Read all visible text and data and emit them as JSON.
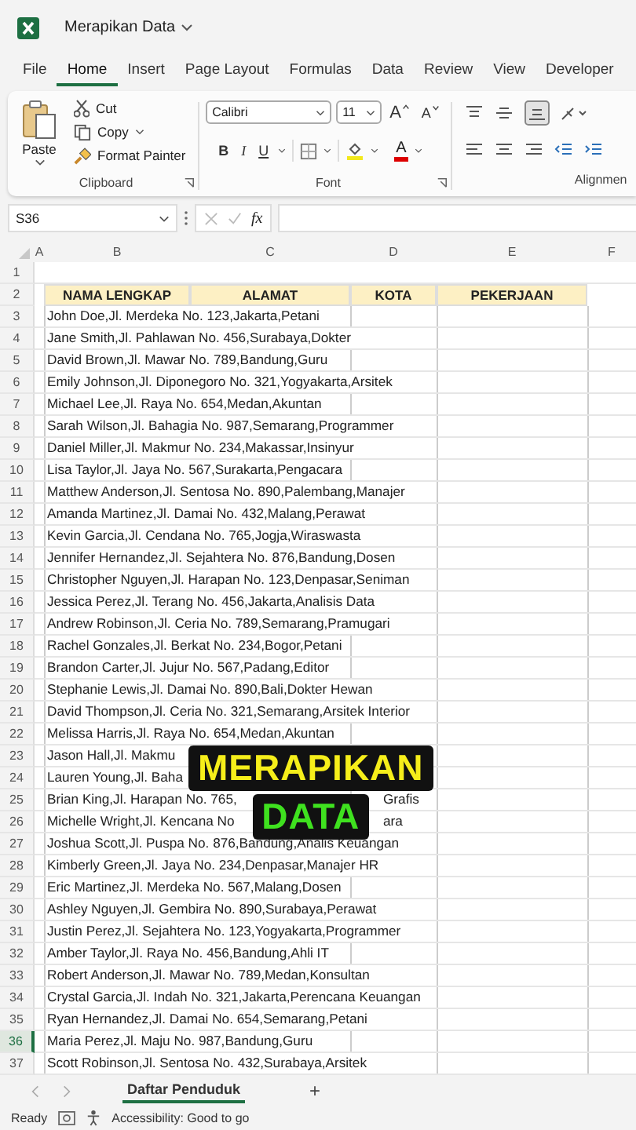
{
  "window": {
    "title": "Merapikan Data"
  },
  "menu_tabs": [
    {
      "label": "File",
      "selected": false
    },
    {
      "label": "Home",
      "selected": true
    },
    {
      "label": "Insert",
      "selected": false
    },
    {
      "label": "Page Layout",
      "selected": false
    },
    {
      "label": "Formulas",
      "selected": false
    },
    {
      "label": "Data",
      "selected": false
    },
    {
      "label": "Review",
      "selected": false
    },
    {
      "label": "View",
      "selected": false
    },
    {
      "label": "Developer",
      "selected": false
    }
  ],
  "ribbon": {
    "clipboard": {
      "paste": "Paste",
      "cut": "Cut",
      "copy": "Copy",
      "format_painter": "Format Painter",
      "label": "Clipboard"
    },
    "font": {
      "family": "Calibri",
      "size": "11",
      "grow": "A",
      "shrink": "A",
      "bold": "B",
      "italic": "I",
      "underline": "U",
      "color_letter": "A",
      "label": "Font"
    },
    "alignment": {
      "label": "Alignmen"
    }
  },
  "formula_bar": {
    "name_box": "S36",
    "function_label": "fx"
  },
  "columns": [
    "A",
    "B",
    "C",
    "D",
    "E",
    "F"
  ],
  "headers": [
    "NAMA LENGKAP",
    "ALAMAT",
    "KOTA",
    "PEKERJAAN"
  ],
  "rows": [
    {
      "number": "1",
      "selected": false
    },
    {
      "number": "2",
      "selected": false,
      "kind": "header"
    },
    {
      "number": "3",
      "selected": false,
      "text": "John Doe,Jl. Merdeka No. 123,Jakarta,Petani"
    },
    {
      "number": "4",
      "selected": false,
      "text": "Jane Smith,Jl. Pahlawan No. 456,Surabaya,Dokter"
    },
    {
      "number": "5",
      "selected": false,
      "text": "David Brown,Jl. Mawar No. 789,Bandung,Guru"
    },
    {
      "number": "6",
      "selected": false,
      "text": "Emily Johnson,Jl. Diponegoro No. 321,Yogyakarta,Arsitek"
    },
    {
      "number": "7",
      "selected": false,
      "text": "Michael Lee,Jl. Raya No. 654,Medan,Akuntan"
    },
    {
      "number": "8",
      "selected": false,
      "text": "Sarah Wilson,Jl. Bahagia No. 987,Semarang,Programmer"
    },
    {
      "number": "9",
      "selected": false,
      "text": "Daniel Miller,Jl. Makmur No. 234,Makassar,Insinyur"
    },
    {
      "number": "10",
      "selected": false,
      "text": "Lisa Taylor,Jl. Jaya No. 567,Surakarta,Pengacara"
    },
    {
      "number": "11",
      "selected": false,
      "text": "Matthew Anderson,Jl. Sentosa No. 890,Palembang,Manajer"
    },
    {
      "number": "12",
      "selected": false,
      "text": "Amanda Martinez,Jl. Damai No. 432,Malang,Perawat"
    },
    {
      "number": "13",
      "selected": false,
      "text": "Kevin Garcia,Jl. Cendana No. 765,Jogja,Wiraswasta"
    },
    {
      "number": "14",
      "selected": false,
      "text": "Jennifer Hernandez,Jl. Sejahtera No. 876,Bandung,Dosen"
    },
    {
      "number": "15",
      "selected": false,
      "text": "Christopher Nguyen,Jl. Harapan No. 123,Denpasar,Seniman"
    },
    {
      "number": "16",
      "selected": false,
      "text": "Jessica Perez,Jl. Terang No. 456,Jakarta,Analisis Data"
    },
    {
      "number": "17",
      "selected": false,
      "text": "Andrew Robinson,Jl. Ceria No. 789,Semarang,Pramugari"
    },
    {
      "number": "18",
      "selected": false,
      "text": "Rachel Gonzales,Jl. Berkat No. 234,Bogor,Petani"
    },
    {
      "number": "19",
      "selected": false,
      "text": "Brandon Carter,Jl. Jujur No. 567,Padang,Editor"
    },
    {
      "number": "20",
      "selected": false,
      "text": "Stephanie Lewis,Jl. Damai No. 890,Bali,Dokter Hewan"
    },
    {
      "number": "21",
      "selected": false,
      "text": "David Thompson,Jl. Ceria No. 321,Semarang,Arsitek Interior"
    },
    {
      "number": "22",
      "selected": false,
      "text": "Melissa Harris,Jl. Raya No. 654,Medan,Akuntan"
    },
    {
      "number": "23",
      "selected": false,
      "text": "Jason Hall,Jl. Makmu"
    },
    {
      "number": "24",
      "selected": false,
      "text": "Lauren Young,Jl. Baha"
    },
    {
      "number": "25",
      "selected": false,
      "text": "Brian King,Jl. Harapan No. 765,",
      "tail": "Grafis"
    },
    {
      "number": "26",
      "selected": false,
      "text": "Michelle Wright,Jl. Kencana No",
      "tail": "ara"
    },
    {
      "number": "27",
      "selected": false,
      "text": "Joshua Scott,Jl. Puspa No. 876,Bandung,Analis Keuangan"
    },
    {
      "number": "28",
      "selected": false,
      "text": "Kimberly Green,Jl. Jaya No. 234,Denpasar,Manajer HR"
    },
    {
      "number": "29",
      "selected": false,
      "text": "Eric Martinez,Jl. Merdeka No. 567,Malang,Dosen"
    },
    {
      "number": "30",
      "selected": false,
      "text": "Ashley Nguyen,Jl. Gembira No. 890,Surabaya,Perawat"
    },
    {
      "number": "31",
      "selected": false,
      "text": "Justin Perez,Jl. Sejahtera No. 123,Yogyakarta,Programmer"
    },
    {
      "number": "32",
      "selected": false,
      "text": "Amber Taylor,Jl. Raya No. 456,Bandung,Ahli IT"
    },
    {
      "number": "33",
      "selected": false,
      "text": "Robert Anderson,Jl. Mawar No. 789,Medan,Konsultan"
    },
    {
      "number": "34",
      "selected": false,
      "text": "Crystal Garcia,Jl. Indah No. 321,Jakarta,Perencana Keuangan"
    },
    {
      "number": "35",
      "selected": false,
      "text": "Ryan Hernandez,Jl. Damai No. 654,Semarang,Petani"
    },
    {
      "number": "36",
      "selected": true,
      "text": "Maria Perez,Jl. Maju No. 987,Bandung,Guru"
    },
    {
      "number": "37",
      "selected": false,
      "text": "Scott Robinson,Jl. Sentosa No. 432,Surabaya,Arsitek"
    }
  ],
  "caption": [
    "MERAPIKAN",
    "DATA"
  ],
  "sheet_tabs": [
    {
      "label": "Daftar Penduduk",
      "selected": true
    }
  ],
  "add_sheet": "+",
  "status_bar": {
    "mode": "Ready",
    "accessibility": "Accessibility: Good to go"
  }
}
